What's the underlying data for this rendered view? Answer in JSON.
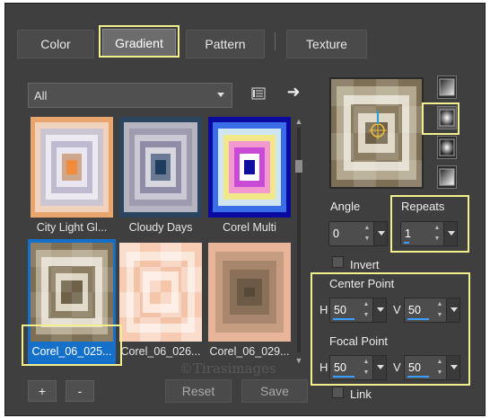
{
  "tabs": [
    {
      "label": "Color"
    },
    {
      "label": "Gradient"
    },
    {
      "label": "Pattern"
    },
    {
      "label": "Texture"
    }
  ],
  "category": {
    "selected": "All"
  },
  "gallery": {
    "items": [
      {
        "label": "City Light Gl..."
      },
      {
        "label": "Cloudy Days"
      },
      {
        "label": "Corel Multi"
      },
      {
        "label": "Corel_06_025..."
      },
      {
        "label": "Corel_06_026..."
      },
      {
        "label": "Corel_06_029..."
      }
    ]
  },
  "angle": {
    "label": "Angle",
    "value": "0"
  },
  "repeats": {
    "label": "Repeats",
    "value": "1"
  },
  "invert": {
    "label": "Invert"
  },
  "center_point": {
    "label": "Center Point",
    "h_label": "H",
    "h_value": "50",
    "v_label": "V",
    "v_value": "50"
  },
  "focal_point": {
    "label": "Focal Point",
    "h_label": "H",
    "h_value": "50",
    "v_label": "V",
    "v_value": "50"
  },
  "link": {
    "label": "Link"
  },
  "buttons": {
    "add": "+",
    "remove": "-",
    "reset": "Reset",
    "save": "Save"
  },
  "watermark": "©Tirasimages",
  "colors": {
    "accent": "#1470c8",
    "highlight": "#f1ef8e"
  }
}
